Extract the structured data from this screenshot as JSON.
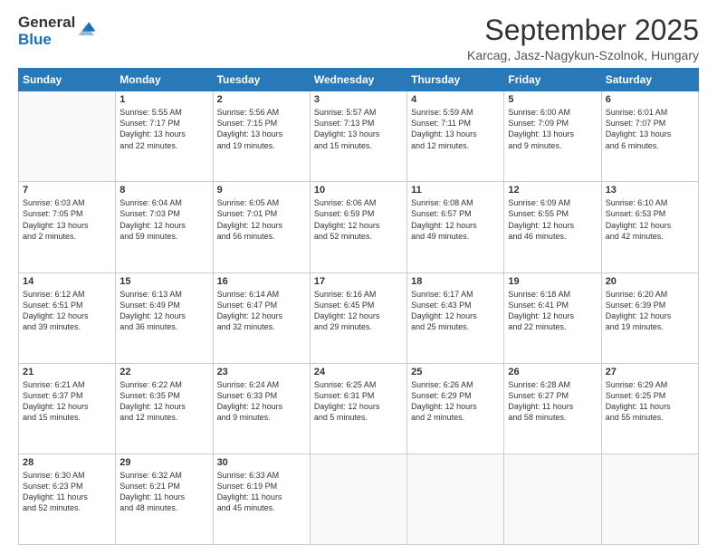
{
  "logo": {
    "general": "General",
    "blue": "Blue"
  },
  "header": {
    "month_title": "September 2025",
    "location": "Karcag, Jasz-Nagykun-Szolnok, Hungary"
  },
  "weekdays": [
    "Sunday",
    "Monday",
    "Tuesday",
    "Wednesday",
    "Thursday",
    "Friday",
    "Saturday"
  ],
  "weeks": [
    [
      {
        "day": null,
        "info": null
      },
      {
        "day": "1",
        "info": "Sunrise: 5:55 AM\nSunset: 7:17 PM\nDaylight: 13 hours\nand 22 minutes."
      },
      {
        "day": "2",
        "info": "Sunrise: 5:56 AM\nSunset: 7:15 PM\nDaylight: 13 hours\nand 19 minutes."
      },
      {
        "day": "3",
        "info": "Sunrise: 5:57 AM\nSunset: 7:13 PM\nDaylight: 13 hours\nand 15 minutes."
      },
      {
        "day": "4",
        "info": "Sunrise: 5:59 AM\nSunset: 7:11 PM\nDaylight: 13 hours\nand 12 minutes."
      },
      {
        "day": "5",
        "info": "Sunrise: 6:00 AM\nSunset: 7:09 PM\nDaylight: 13 hours\nand 9 minutes."
      },
      {
        "day": "6",
        "info": "Sunrise: 6:01 AM\nSunset: 7:07 PM\nDaylight: 13 hours\nand 6 minutes."
      }
    ],
    [
      {
        "day": "7",
        "info": "Sunrise: 6:03 AM\nSunset: 7:05 PM\nDaylight: 13 hours\nand 2 minutes."
      },
      {
        "day": "8",
        "info": "Sunrise: 6:04 AM\nSunset: 7:03 PM\nDaylight: 12 hours\nand 59 minutes."
      },
      {
        "day": "9",
        "info": "Sunrise: 6:05 AM\nSunset: 7:01 PM\nDaylight: 12 hours\nand 56 minutes."
      },
      {
        "day": "10",
        "info": "Sunrise: 6:06 AM\nSunset: 6:59 PM\nDaylight: 12 hours\nand 52 minutes."
      },
      {
        "day": "11",
        "info": "Sunrise: 6:08 AM\nSunset: 6:57 PM\nDaylight: 12 hours\nand 49 minutes."
      },
      {
        "day": "12",
        "info": "Sunrise: 6:09 AM\nSunset: 6:55 PM\nDaylight: 12 hours\nand 46 minutes."
      },
      {
        "day": "13",
        "info": "Sunrise: 6:10 AM\nSunset: 6:53 PM\nDaylight: 12 hours\nand 42 minutes."
      }
    ],
    [
      {
        "day": "14",
        "info": "Sunrise: 6:12 AM\nSunset: 6:51 PM\nDaylight: 12 hours\nand 39 minutes."
      },
      {
        "day": "15",
        "info": "Sunrise: 6:13 AM\nSunset: 6:49 PM\nDaylight: 12 hours\nand 36 minutes."
      },
      {
        "day": "16",
        "info": "Sunrise: 6:14 AM\nSunset: 6:47 PM\nDaylight: 12 hours\nand 32 minutes."
      },
      {
        "day": "17",
        "info": "Sunrise: 6:16 AM\nSunset: 6:45 PM\nDaylight: 12 hours\nand 29 minutes."
      },
      {
        "day": "18",
        "info": "Sunrise: 6:17 AM\nSunset: 6:43 PM\nDaylight: 12 hours\nand 25 minutes."
      },
      {
        "day": "19",
        "info": "Sunrise: 6:18 AM\nSunset: 6:41 PM\nDaylight: 12 hours\nand 22 minutes."
      },
      {
        "day": "20",
        "info": "Sunrise: 6:20 AM\nSunset: 6:39 PM\nDaylight: 12 hours\nand 19 minutes."
      }
    ],
    [
      {
        "day": "21",
        "info": "Sunrise: 6:21 AM\nSunset: 6:37 PM\nDaylight: 12 hours\nand 15 minutes."
      },
      {
        "day": "22",
        "info": "Sunrise: 6:22 AM\nSunset: 6:35 PM\nDaylight: 12 hours\nand 12 minutes."
      },
      {
        "day": "23",
        "info": "Sunrise: 6:24 AM\nSunset: 6:33 PM\nDaylight: 12 hours\nand 9 minutes."
      },
      {
        "day": "24",
        "info": "Sunrise: 6:25 AM\nSunset: 6:31 PM\nDaylight: 12 hours\nand 5 minutes."
      },
      {
        "day": "25",
        "info": "Sunrise: 6:26 AM\nSunset: 6:29 PM\nDaylight: 12 hours\nand 2 minutes."
      },
      {
        "day": "26",
        "info": "Sunrise: 6:28 AM\nSunset: 6:27 PM\nDaylight: 11 hours\nand 58 minutes."
      },
      {
        "day": "27",
        "info": "Sunrise: 6:29 AM\nSunset: 6:25 PM\nDaylight: 11 hours\nand 55 minutes."
      }
    ],
    [
      {
        "day": "28",
        "info": "Sunrise: 6:30 AM\nSunset: 6:23 PM\nDaylight: 11 hours\nand 52 minutes."
      },
      {
        "day": "29",
        "info": "Sunrise: 6:32 AM\nSunset: 6:21 PM\nDaylight: 11 hours\nand 48 minutes."
      },
      {
        "day": "30",
        "info": "Sunrise: 6:33 AM\nSunset: 6:19 PM\nDaylight: 11 hours\nand 45 minutes."
      },
      {
        "day": null,
        "info": null
      },
      {
        "day": null,
        "info": null
      },
      {
        "day": null,
        "info": null
      },
      {
        "day": null,
        "info": null
      }
    ]
  ]
}
